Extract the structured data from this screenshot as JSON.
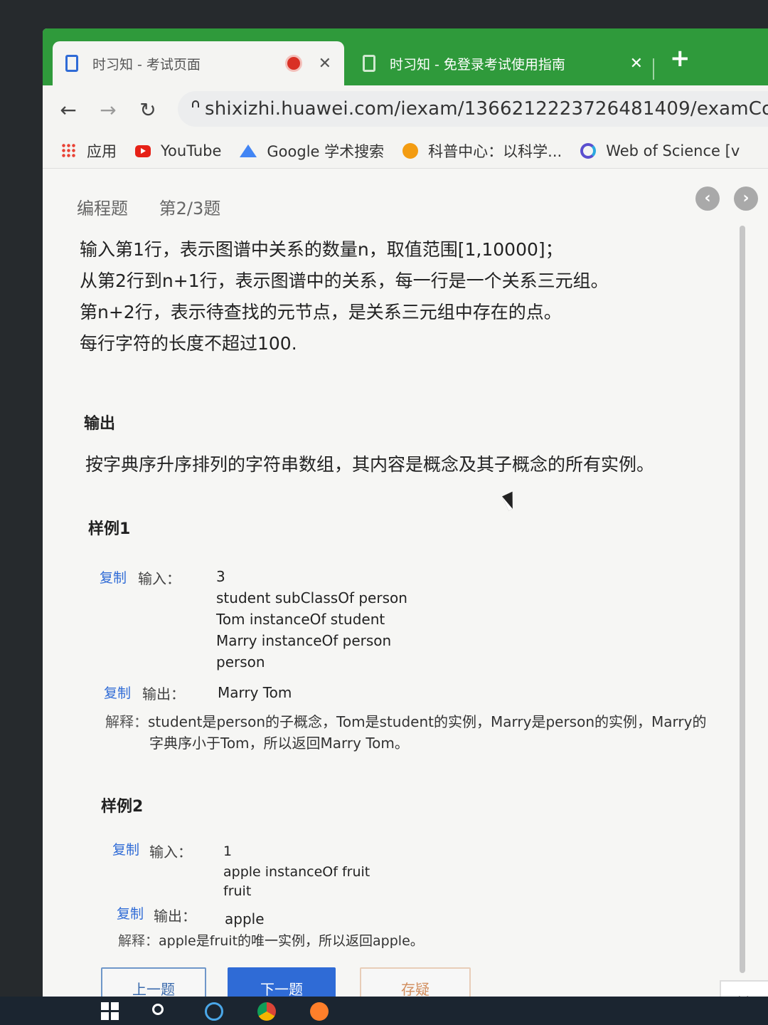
{
  "browser": {
    "tabs": [
      {
        "title": "时习知 - 考试页面",
        "active": true,
        "recording": true
      },
      {
        "title": "时习知 - 免登录考试使用指南",
        "active": false
      }
    ],
    "url": "shixizhi.huawei.com/iexam/1366212223726481409/examContent",
    "bookmarks": [
      {
        "label": "应用",
        "icon": "apps-icon"
      },
      {
        "label": "YouTube",
        "icon": "youtube-icon"
      },
      {
        "label": "Google 学术搜索",
        "icon": "scholar-icon"
      },
      {
        "label": "科普中心：以科学...",
        "icon": "kepu-icon"
      },
      {
        "label": "Web of Science [v",
        "icon": "wos-icon"
      }
    ],
    "colors": {
      "tab_strip": "#2f9a3b",
      "accent": "#2f6bd6"
    }
  },
  "question": {
    "type": "编程题",
    "progress": "第2/3题",
    "description": [
      "输入第1行，表示图谱中关系的数量n，取值范围[1,10000]；",
      "从第2行到n+1行，表示图谱中的关系，每一行是一个关系三元组。",
      "第n+2行，表示待查找的元节点，是关系三元组中存在的点。",
      "每行字符的长度不超过100."
    ],
    "output_title": "输出",
    "output_text": "按字典序升序排列的字符串数组，其内容是概念及其子概念的所有实例。"
  },
  "samples": [
    {
      "title": "样例1",
      "copy": "复制",
      "input_label": "输入：",
      "input_lines": [
        "3",
        "student subClassOf person",
        "Tom instanceOf student",
        "Marry instanceOf person",
        "person"
      ],
      "output_label": "输出：",
      "output": "Marry Tom",
      "explain_label": "解释：",
      "explain_lines": [
        "student是person的子概念，Tom是student的实例，Marry是person的实例，Marry的",
        "字典序小于Tom，所以返回Marry Tom。"
      ]
    },
    {
      "title": "样例2",
      "copy": "复制",
      "input_label": "输入：",
      "input_lines": [
        "1",
        "apple instanceOf fruit",
        "fruit"
      ],
      "output_label": "输出：",
      "output": "apple",
      "explain_label": "解释：",
      "explain_lines": [
        "apple是fruit的唯一实例，所以返回apple。"
      ]
    }
  ],
  "buttons": {
    "prev": "上一题",
    "next": "下一题",
    "save": "存疑"
  },
  "side_tip": "shi"
}
